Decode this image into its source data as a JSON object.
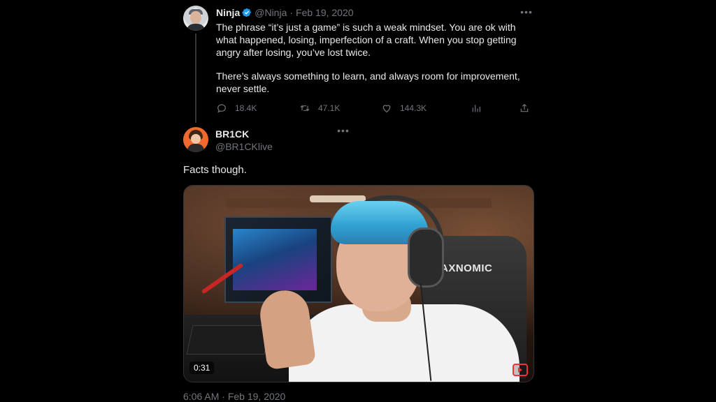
{
  "ninja_tweet": {
    "name": "Ninja",
    "handle": "@Ninja",
    "separator": "·",
    "date": "Feb 19, 2020",
    "paragraphs": [
      "The phrase “it’s just a game” is such a weak mindset. You are ok with what happened, losing, imperfection of a craft. When you stop getting angry after losing, you’ve lost twice.",
      "There’s always something to learn, and always room for improvement, never settle."
    ],
    "replies": "18.4K",
    "retweets": "47.1K",
    "likes": "144.3K",
    "icons": [
      "verified-icon",
      "reply-icon",
      "retweet-icon",
      "like-icon",
      "views-icon",
      "share-icon",
      "more-icon"
    ]
  },
  "brick_reply": {
    "name": "BR1CK",
    "handle": "@BR1CKlive",
    "text": "Facts though."
  },
  "video": {
    "duration": "0:31",
    "chair_brand": "MAXNOMIC",
    "icons": [
      "youtube-icon"
    ]
  },
  "post_meta": {
    "time": "6:06 AM",
    "separator": "·",
    "date": "Feb 19, 2020"
  },
  "colors": {
    "background": "#000000",
    "text_primary": "#e7e9ea",
    "text_secondary": "#71767b",
    "verified_blue": "#1d9bf0",
    "border": "#2f3336"
  }
}
